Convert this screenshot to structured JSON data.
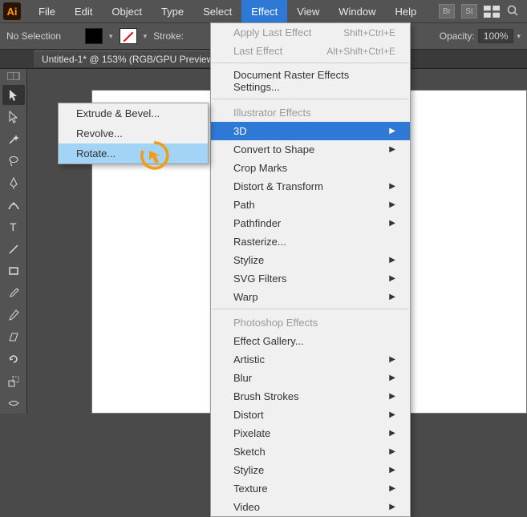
{
  "menubar": {
    "logo": "Ai",
    "items": [
      "File",
      "Edit",
      "Object",
      "Type",
      "Select",
      "Effect",
      "View",
      "Window",
      "Help"
    ],
    "active_index": 5,
    "right_icons": [
      "Br",
      "St"
    ]
  },
  "controlbar": {
    "selection": "No Selection",
    "stroke_label": "Stroke:",
    "opacity_label": "Opacity:",
    "opacity_value": "100%"
  },
  "document": {
    "tab_title": "Untitled-1* @ 153% (RGB/GPU Preview)"
  },
  "tools": [
    "selection",
    "direct-selection",
    "magic-wand",
    "lasso",
    "pen",
    "curvature",
    "type",
    "line",
    "rectangle",
    "paintbrush",
    "pencil",
    "eraser",
    "rotate",
    "scale"
  ],
  "effect_menu": {
    "apply_last": {
      "label": "Apply Last Effect",
      "shortcut": "Shift+Ctrl+E"
    },
    "last": {
      "label": "Last Effect",
      "shortcut": "Alt+Shift+Ctrl+E"
    },
    "raster_settings": "Document Raster Effects Settings...",
    "heading1": "Illustrator Effects",
    "illustrator": [
      "3D",
      "Convert to Shape",
      "Crop Marks",
      "Distort & Transform",
      "Path",
      "Pathfinder",
      "Rasterize...",
      "Stylize",
      "SVG Filters",
      "Warp"
    ],
    "heading2": "Photoshop Effects",
    "gallery": "Effect Gallery...",
    "photoshop": [
      "Artistic",
      "Blur",
      "Brush Strokes",
      "Distort",
      "Pixelate",
      "Sketch",
      "Stylize",
      "Texture",
      "Video"
    ]
  },
  "submenu_3d": [
    "Extrude & Bevel...",
    "Revolve...",
    "Rotate..."
  ]
}
